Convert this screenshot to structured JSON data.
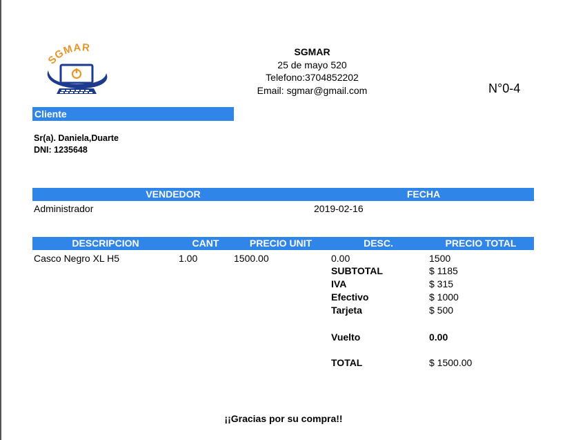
{
  "company": {
    "name": "SGMAR",
    "address": "25 de mayo 520",
    "phone": "Telefono:3704852202",
    "email": "Email: sgmar@gmail.com",
    "logo_text": "SGMAR"
  },
  "invoice_number": "N°0-4",
  "client": {
    "section_label": "Cliente",
    "name": "Sr(a). Daniela,Duarte",
    "dni": "DNI: 1235648"
  },
  "sale_info": {
    "headers": {
      "seller": "VENDEDOR",
      "date": "FECHA"
    },
    "seller": "Administrador",
    "date": "2019-02-16"
  },
  "items_table": {
    "headers": {
      "description": "DESCRIPCION",
      "qty": "CANT",
      "unit_price": "PRECIO UNIT",
      "discount": "DESC.",
      "total": "PRECIO TOTAL"
    },
    "rows": [
      {
        "description": "Casco Negro XL H5",
        "qty": "1.00",
        "unit_price": "1500.00",
        "discount": "0.00",
        "total": "1500"
      }
    ]
  },
  "totals": {
    "subtotal_label": "SUBTOTAL",
    "subtotal": "$ 1185",
    "iva_label": "IVA",
    "iva": "$ 315",
    "cash_label": "Efectivo",
    "cash": "$ 1000",
    "card_label": "Tarjeta",
    "card": "$ 500",
    "change_label": "Vuelto",
    "change": "0.00",
    "total_label": "TOTAL",
    "total": "$ 1500.00"
  },
  "footer": {
    "thanks": "¡¡Gracias por su compra!!"
  },
  "colors": {
    "accent": "#2f86e8",
    "logo_orange": "#e8962a",
    "logo_blue": "#1c3a8e"
  }
}
